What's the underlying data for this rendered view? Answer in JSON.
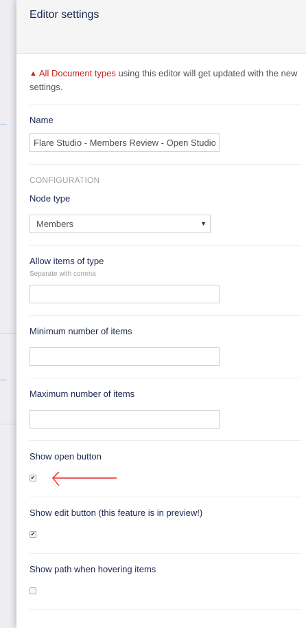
{
  "panel": {
    "title": "Editor settings"
  },
  "notice": {
    "icon": "warning-icon",
    "icon_glyph": "▲",
    "highlight": "All Document types",
    "text": " using this editor will get updated with the new settings."
  },
  "fields": {
    "name": {
      "label": "Name",
      "value": "Flare Studio - Members Review - Open Studio"
    },
    "configuration_heading": "CONFIGURATION",
    "node_type": {
      "label": "Node type",
      "selected": "Members",
      "arrow": "▼"
    },
    "allow_items": {
      "label": "Allow items of type",
      "description": "Separate with comma",
      "value": ""
    },
    "min_items": {
      "label": "Minimum number of items",
      "value": ""
    },
    "max_items": {
      "label": "Maximum number of items",
      "value": ""
    },
    "show_open_button": {
      "label": "Show open button",
      "checked": true,
      "check_glyph": "✔"
    },
    "show_edit_button": {
      "label": "Show edit button (this feature is in preview!)",
      "checked": true,
      "check_glyph": "✔"
    },
    "show_path": {
      "label": "Show path when hovering items",
      "checked": false,
      "check_glyph": ""
    }
  },
  "colors": {
    "accent_red": "#c4221d",
    "text_dark": "#1b264f",
    "annotation_arrow": "#e8262b"
  }
}
